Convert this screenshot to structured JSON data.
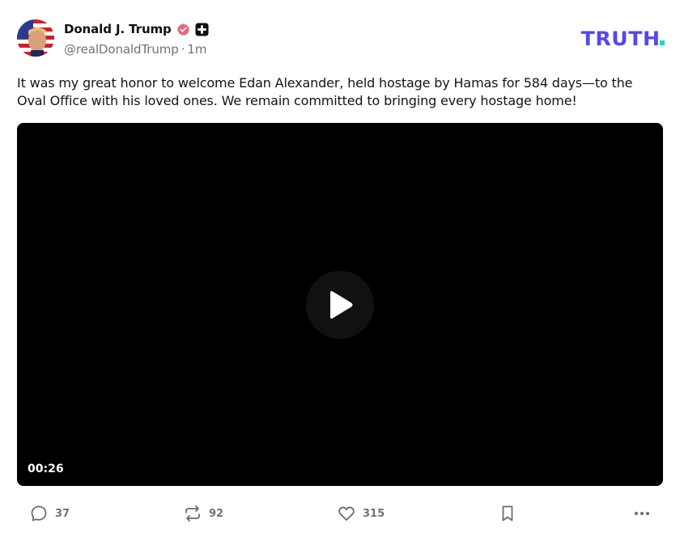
{
  "post": {
    "author": {
      "display_name": "Donald J. Trump",
      "handle": "@realDonaldTrump",
      "time_ago": "1m",
      "separator": "·",
      "verified_icon": "verified-badge-icon",
      "plus_icon": "plus-badge-icon"
    },
    "text": "It was my great honor to welcome Edan Alexander, held hostage by Hamas for 584 days—to the Oval Office with his loved ones. We remain committed to bringing every hostage home!",
    "video": {
      "duration": "00:26",
      "play_icon": "play-icon"
    },
    "stats": {
      "replies": "37",
      "retruths": "92",
      "likes": "315"
    }
  },
  "brand": {
    "logo_text": "TRUTH",
    "colors": {
      "primary": "#5448ee",
      "dot": "#17d7c5"
    }
  },
  "colors": {
    "verified": "#e36b7b",
    "muted": "#71717a",
    "text": "#14141a"
  }
}
